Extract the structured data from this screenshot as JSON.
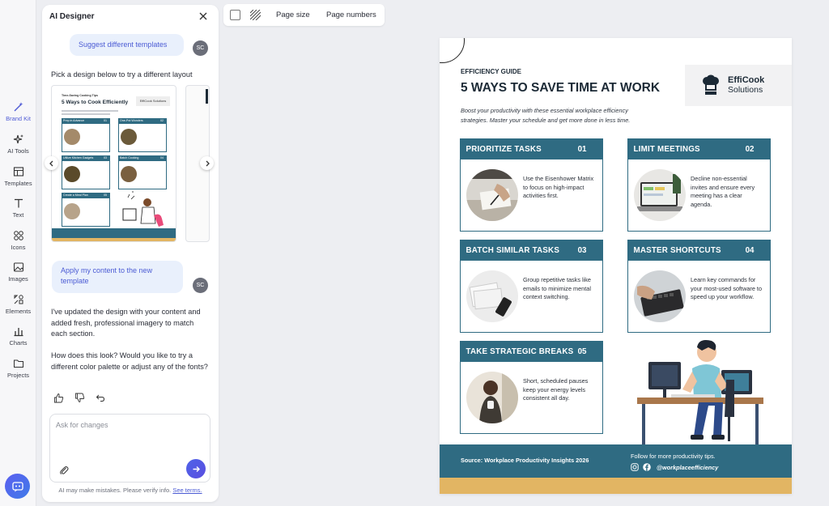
{
  "rail": {
    "items": [
      {
        "label": "Brand Kit",
        "icon": "magic-wand-icon",
        "active": true
      },
      {
        "label": "AI Tools",
        "icon": "sparkles-icon"
      },
      {
        "label": "Templates",
        "icon": "templates-icon"
      },
      {
        "label": "Text",
        "icon": "text-icon"
      },
      {
        "label": "Icons",
        "icon": "shapes-icon"
      },
      {
        "label": "Images",
        "icon": "image-icon"
      },
      {
        "label": "Elements",
        "icon": "elements-icon"
      },
      {
        "label": "Charts",
        "icon": "bar-chart-icon"
      },
      {
        "label": "Projects",
        "icon": "folder-icon"
      }
    ]
  },
  "panel": {
    "title": "AI Designer",
    "user_initials": "SC",
    "msg1": "Suggest different templates",
    "pick_text": "Pick a design below to try a different layout",
    "msg2": "Apply my content to the new template",
    "reply1": "I've updated the design with your content and added fresh, professional imagery to match each section.",
    "reply2": "How does this look? Would you like to try a different color palette or adjust any of the fonts?",
    "input_placeholder": "Ask for changes",
    "disclaimer": "AI may make mistakes. Please verify info.",
    "terms_link": "See terms."
  },
  "template_preview": {
    "eyebrow": "Time-Saving Cooking Tips",
    "title": "5 Ways to Cook Efficiently",
    "brand": "EffiCook Solutions",
    "sections": [
      "Prep in Advance",
      "One-Pot Wonders",
      "Utilize Kitchen Gadgets",
      "Batch Cooking",
      "Create a Meal Plan"
    ],
    "nums": [
      "01",
      "02",
      "03",
      "04",
      "05"
    ]
  },
  "toolbar": {
    "page_size": "Page size",
    "page_numbers": "Page numbers"
  },
  "document": {
    "eyebrow": "EFFICIENCY GUIDE",
    "title": "5 WAYS TO SAVE TIME AT WORK",
    "subtitle": "Boost your productivity with these essential workplace efficiency strategies. Master your schedule and get more done in less time.",
    "logo_name": "EffiCook",
    "logo_sub": "Solutions",
    "tips": [
      {
        "title": "PRIORITIZE TASKS",
        "num": "01",
        "text": "Use the Eisenhower Matrix to focus on high-impact activities first."
      },
      {
        "title": "LIMIT MEETINGS",
        "num": "02",
        "text": "Decline non-essential invites and ensure every meeting has a clear agenda."
      },
      {
        "title": "BATCH SIMILAR TASKS",
        "num": "03",
        "text": "Group repetitive tasks like emails to minimize mental context switching."
      },
      {
        "title": "MASTER SHORTCUTS",
        "num": "04",
        "text": "Learn key commands for your most-used software to speed up your workflow."
      },
      {
        "title": "TAKE STRATEGIC BREAKS",
        "num": "05",
        "text": "Short, scheduled pauses keep your energy levels consistent all day."
      }
    ],
    "footer_source": "Source: Workplace Productivity Insights 2026",
    "footer_follow": "Follow for more productivity tips.",
    "footer_handle": "@workplaceefficiency"
  },
  "colors": {
    "accent": "#2f6b82",
    "gold": "#e2b563",
    "brand": "#4f5bd5"
  }
}
